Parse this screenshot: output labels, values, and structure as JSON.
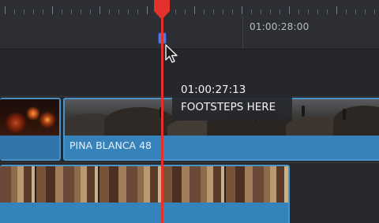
{
  "ruler": {
    "timecode_label": "01:00:28:00"
  },
  "clips": {
    "upper_track_clip_name": "PINA BLANCA 48"
  },
  "tooltip": {
    "timecode": "01:00:27:13",
    "marker_note": "FOOTSTEPS HERE"
  },
  "icons": {
    "playhead": "playhead-icon",
    "marker": "marker-icon",
    "cursor": "pointer-cursor-icon"
  },
  "colors": {
    "playhead": "#e3322c",
    "marker": "#4d7ae3",
    "clip": "#3580b6",
    "background": "#26282c"
  }
}
